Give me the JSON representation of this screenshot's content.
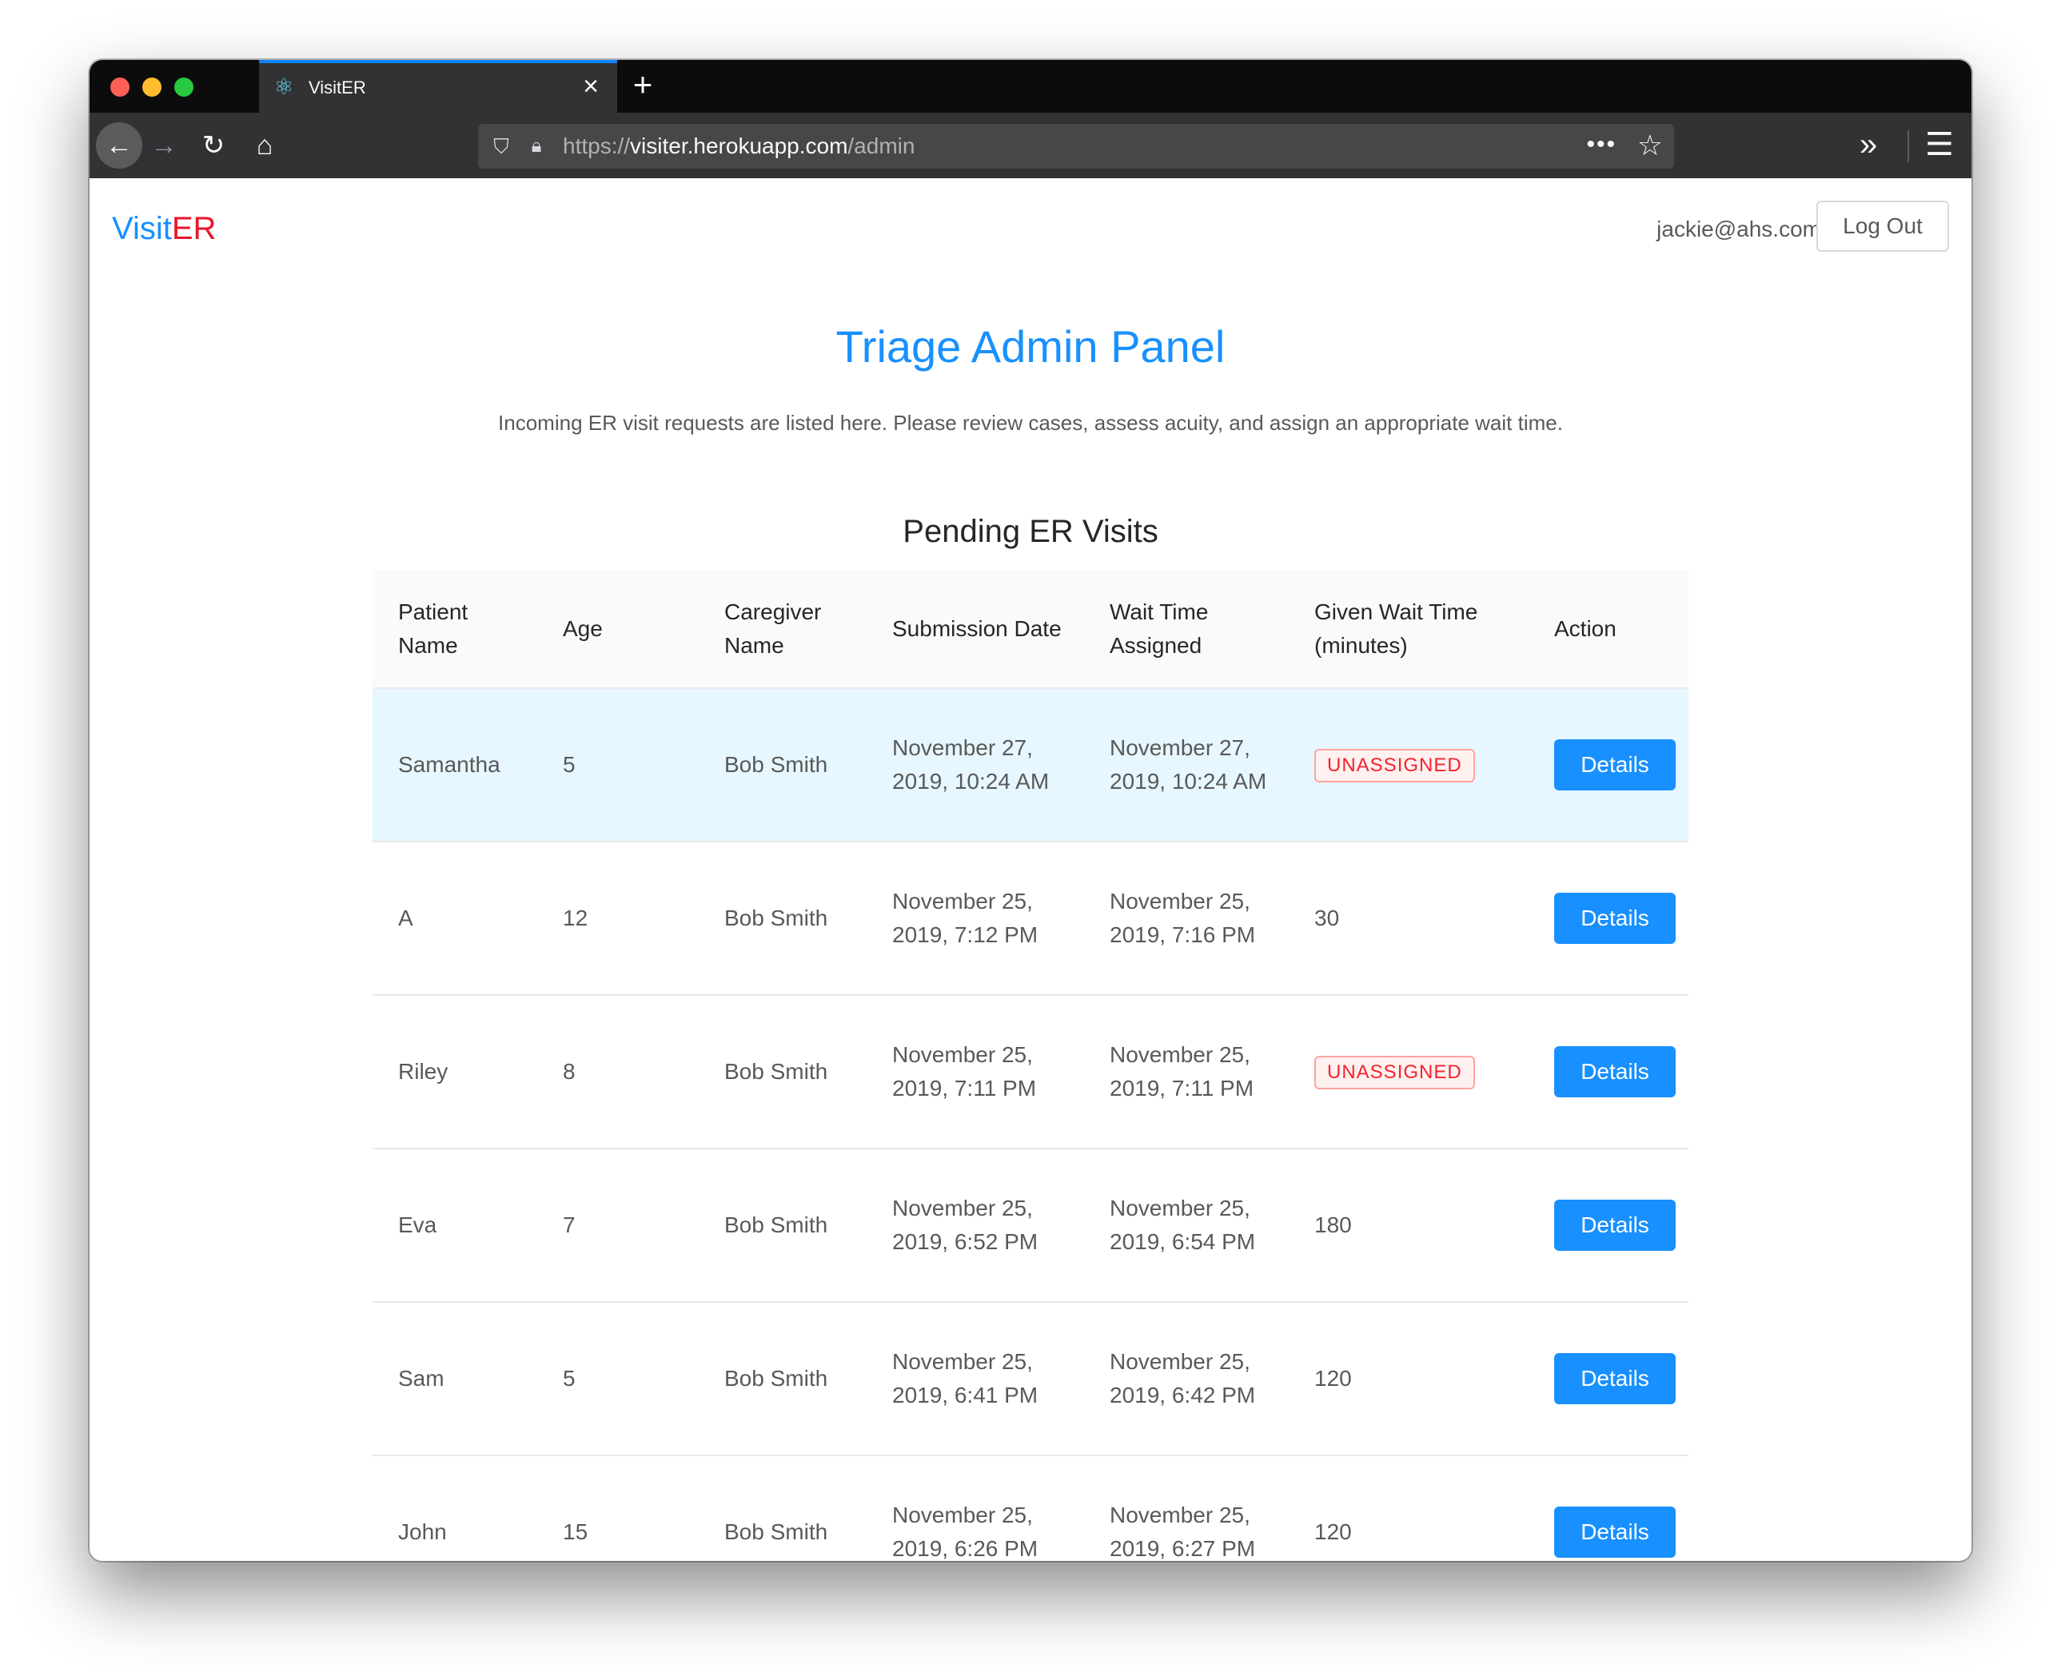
{
  "browser": {
    "tab_icon": "react-atom-icon",
    "tab_title": "VisitER",
    "url_scheme": "https://",
    "url_host": "visiter.herokuapp.com",
    "url_path": "/admin"
  },
  "header": {
    "brand_visit": "Visit",
    "brand_er": "ER",
    "user_email": "jackie@ahs.com",
    "logout_label": "Log Out"
  },
  "main": {
    "title": "Triage Admin Panel",
    "description": "Incoming ER visit requests are listed here. Please review cases, assess acuity, and assign an appropriate wait time.",
    "section_title": "Pending ER Visits",
    "columns": [
      "Patient Name",
      "Age",
      "Caregiver Name",
      "Submission Date",
      "Wait Time Assigned",
      "Given Wait Time (minutes)",
      "Action"
    ],
    "rows": [
      {
        "patient": "Samantha",
        "age": "5",
        "caregiver": "Bob Smith",
        "submitted": "November 27, 2019, 10:24 AM",
        "assigned": "November 27, 2019, 10:24 AM",
        "wait": "UNASSIGNED",
        "action": "Details"
      },
      {
        "patient": "A",
        "age": "12",
        "caregiver": "Bob Smith",
        "submitted": "November 25, 2019, 7:12 PM",
        "assigned": "November 25, 2019, 7:16 PM",
        "wait": "30",
        "action": "Details"
      },
      {
        "patient": "Riley",
        "age": "8",
        "caregiver": "Bob Smith",
        "submitted": "November 25, 2019, 7:11 PM",
        "assigned": "November 25, 2019, 7:11 PM",
        "wait": "UNASSIGNED",
        "action": "Details"
      },
      {
        "patient": "Eva",
        "age": "7",
        "caregiver": "Bob Smith",
        "submitted": "November 25, 2019, 6:52 PM",
        "assigned": "November 25, 2019, 6:54 PM",
        "wait": "180",
        "action": "Details"
      },
      {
        "patient": "Sam",
        "age": "5",
        "caregiver": "Bob Smith",
        "submitted": "November 25, 2019, 6:41 PM",
        "assigned": "November 25, 2019, 6:42 PM",
        "wait": "120",
        "action": "Details"
      },
      {
        "patient": "John",
        "age": "15",
        "caregiver": "Bob Smith",
        "submitted": "November 25, 2019, 6:26 PM",
        "assigned": "November 25, 2019, 6:27 PM",
        "wait": "120",
        "action": "Details"
      }
    ]
  },
  "colors": {
    "accent": "#1890ff",
    "brand_er": "#e8162d",
    "selected_row": "#e6f7ff",
    "unassigned": "#f5222d"
  }
}
